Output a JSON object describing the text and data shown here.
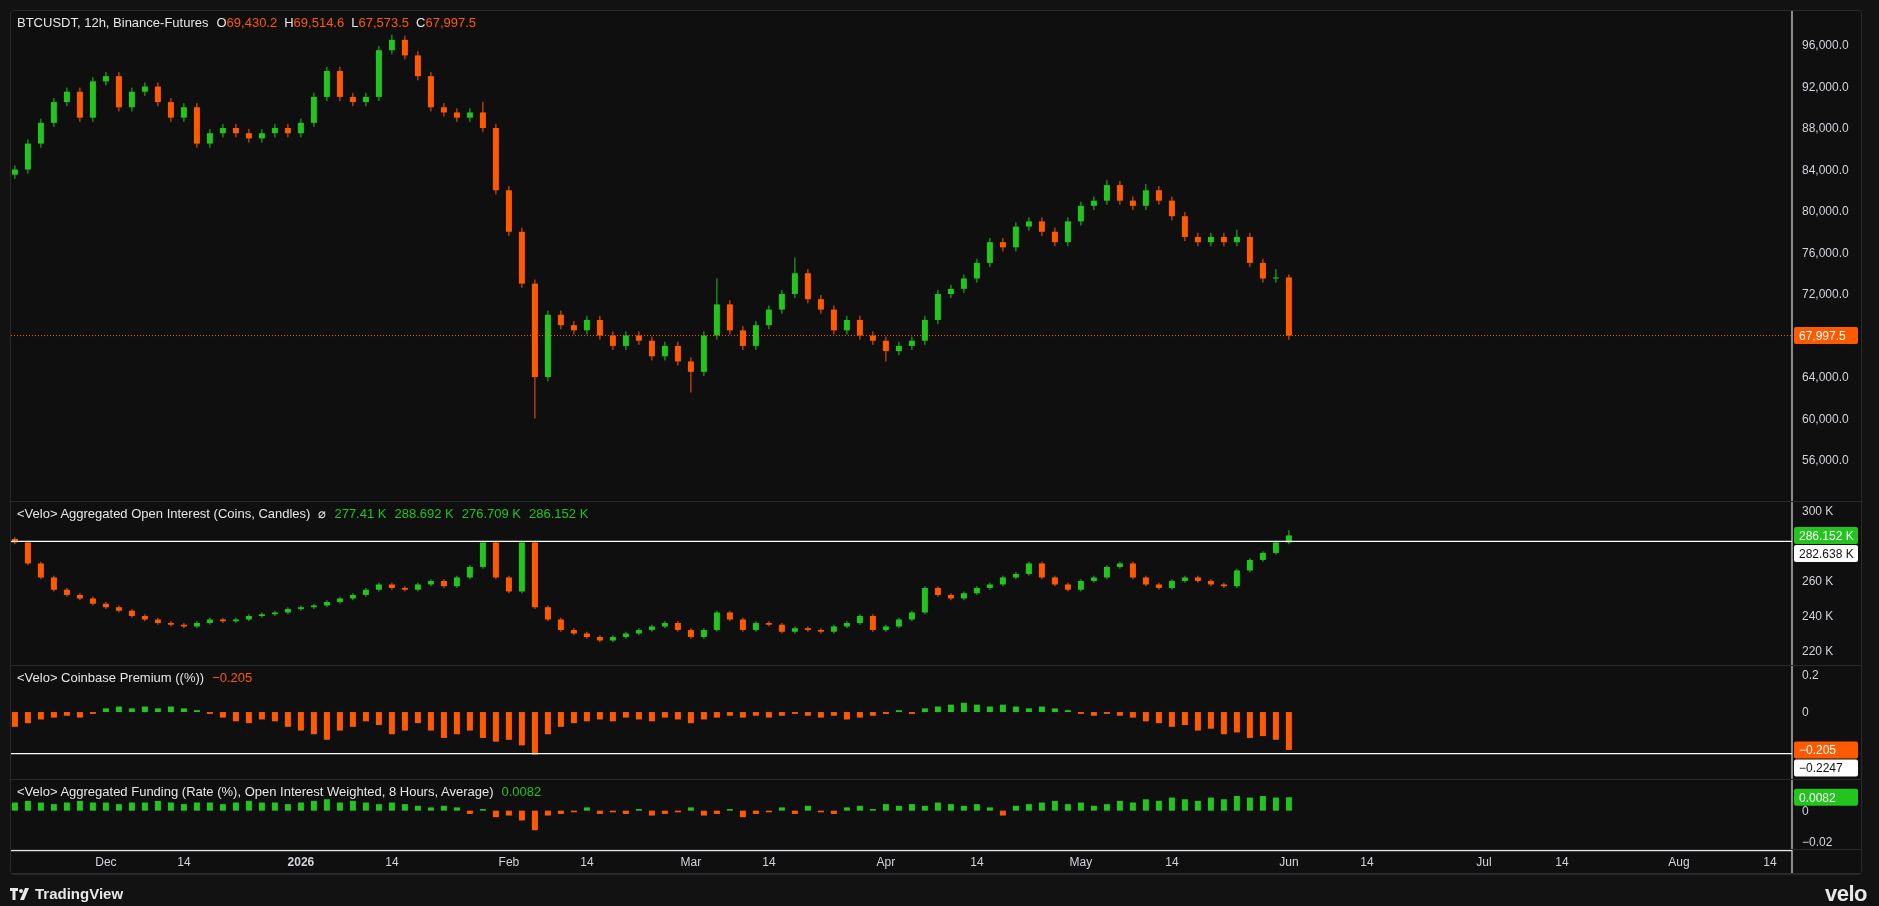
{
  "price_pane": {
    "legend": {
      "title": "BTCUSDT, 12h, Binance-Futures",
      "ohlc": [
        {
          "key": "O",
          "value": "69,430.2",
          "falling": true
        },
        {
          "key": "H",
          "value": "69,514.6",
          "falling": true
        },
        {
          "key": "L",
          "value": "67,573.5",
          "falling": true
        },
        {
          "key": "C",
          "value": "67,997.5",
          "falling": true
        }
      ]
    },
    "chart_data": {
      "type": "candlestick",
      "ylim": [
        52050,
        99280
      ],
      "categories": [
        null,
        null,
        null,
        null,
        null,
        null,
        null,
        null,
        null,
        null,
        null,
        null,
        null,
        null,
        null,
        null,
        null,
        null,
        null,
        null,
        null,
        null,
        null,
        null,
        null,
        null,
        null,
        null,
        null,
        null,
        null,
        null,
        null,
        null,
        null,
        null,
        null,
        null,
        null,
        null,
        null,
        null,
        null,
        null,
        null,
        null,
        null,
        null,
        null,
        null,
        null,
        null,
        null,
        null,
        null,
        null,
        null,
        null,
        null,
        null,
        null,
        null,
        null,
        null,
        null,
        null,
        null,
        null,
        null,
        null,
        null,
        null,
        null,
        null,
        null,
        null,
        null,
        null,
        null,
        null,
        null,
        null,
        null,
        null,
        null,
        null,
        null,
        null,
        null,
        null,
        null,
        null,
        null,
        null,
        null,
        null,
        null,
        null,
        null,
        null,
        null,
        null,
        null,
        null,
        null,
        null,
        null,
        null,
        null,
        null,
        null,
        null,
        null,
        null,
        null,
        null,
        null,
        null,
        null,
        null,
        null,
        null,
        null,
        null,
        null,
        null,
        null,
        null,
        null,
        null,
        null,
        null,
        null,
        null,
        null,
        null,
        null
      ],
      "ohlc": [
        [
          83500,
          84400,
          83100,
          84000
        ],
        [
          84000,
          86900,
          83600,
          86500
        ],
        [
          86500,
          88900,
          86100,
          88500
        ],
        [
          88500,
          90900,
          88100,
          90500
        ],
        [
          90500,
          91900,
          90100,
          91500
        ],
        [
          91500,
          91900,
          88600,
          89000
        ],
        [
          89000,
          92900,
          88600,
          92500
        ],
        [
          92500,
          93400,
          92100,
          93000
        ],
        [
          93000,
          93400,
          89600,
          90000
        ],
        [
          90000,
          91900,
          89600,
          91500
        ],
        [
          91500,
          92400,
          91100,
          92000
        ],
        [
          92000,
          92400,
          90100,
          90500
        ],
        [
          90500,
          90900,
          88600,
          89000
        ],
        [
          89000,
          90400,
          88600,
          90000
        ],
        [
          90000,
          90400,
          86100,
          86500
        ],
        [
          86500,
          87900,
          86100,
          87500
        ],
        [
          87500,
          88400,
          87100,
          88000
        ],
        [
          88000,
          88400,
          87100,
          87500
        ],
        [
          87500,
          87900,
          86600,
          87000
        ],
        [
          87000,
          87900,
          86600,
          87500
        ],
        [
          87500,
          88400,
          87100,
          88000
        ],
        [
          88000,
          88400,
          87100,
          87500
        ],
        [
          87500,
          88900,
          87100,
          88500
        ],
        [
          88500,
          91400,
          88100,
          91000
        ],
        [
          91000,
          93900,
          90600,
          93500
        ],
        [
          93500,
          93900,
          90600,
          91000
        ],
        [
          91000,
          91400,
          90100,
          90500
        ],
        [
          90500,
          91400,
          90100,
          91000
        ],
        [
          91000,
          95900,
          90600,
          95500
        ],
        [
          95500,
          97000,
          95100,
          96500
        ],
        [
          96500,
          96900,
          94600,
          95000
        ],
        [
          95000,
          95400,
          92600,
          93000
        ],
        [
          93000,
          93400,
          89600,
          90000
        ],
        [
          90000,
          90400,
          89100,
          89500
        ],
        [
          89500,
          89900,
          88600,
          89000
        ],
        [
          89000,
          89900,
          88600,
          89500
        ],
        [
          89500,
          90500,
          87600,
          88000
        ],
        [
          88000,
          88400,
          81600,
          82000
        ],
        [
          82000,
          82400,
          77600,
          78000
        ],
        [
          78000,
          78400,
          72600,
          73000
        ],
        [
          73000,
          73400,
          60000,
          64000
        ],
        [
          64000,
          70400,
          63600,
          70000
        ],
        [
          70000,
          70400,
          68600,
          69000
        ],
        [
          69000,
          69400,
          68100,
          68500
        ],
        [
          68500,
          69900,
          68100,
          69500
        ],
        [
          69500,
          69900,
          67600,
          68000
        ],
        [
          68000,
          68400,
          66600,
          67000
        ],
        [
          67000,
          68400,
          66600,
          68000
        ],
        [
          68000,
          68400,
          67100,
          67500
        ],
        [
          67500,
          67900,
          65600,
          66000
        ],
        [
          66000,
          67400,
          65600,
          67000
        ],
        [
          67000,
          67400,
          65100,
          65500
        ],
        [
          65500,
          65900,
          62500,
          64500
        ],
        [
          64500,
          68400,
          64100,
          68000
        ],
        [
          68000,
          73500,
          67600,
          71000
        ],
        [
          71000,
          71400,
          68100,
          68500
        ],
        [
          68500,
          68900,
          66600,
          67000
        ],
        [
          67000,
          69400,
          66600,
          69000
        ],
        [
          69000,
          70900,
          68600,
          70500
        ],
        [
          70500,
          72400,
          70100,
          72000
        ],
        [
          72000,
          75500,
          71600,
          74000
        ],
        [
          74000,
          74400,
          71100,
          71500
        ],
        [
          71500,
          71900,
          70100,
          70500
        ],
        [
          70500,
          70900,
          68100,
          68500
        ],
        [
          68500,
          69900,
          68100,
          69500
        ],
        [
          69500,
          69900,
          67600,
          68000
        ],
        [
          68000,
          68400,
          67100,
          67500
        ],
        [
          67500,
          67900,
          65500,
          66500
        ],
        [
          66500,
          67400,
          66100,
          67000
        ],
        [
          67000,
          67900,
          66600,
          67500
        ],
        [
          67500,
          69900,
          67100,
          69500
        ],
        [
          69500,
          72400,
          69100,
          72000
        ],
        [
          72000,
          72900,
          71600,
          72500
        ],
        [
          72500,
          73900,
          72100,
          73500
        ],
        [
          73500,
          75400,
          73100,
          75000
        ],
        [
          75000,
          77400,
          74600,
          77000
        ],
        [
          77000,
          77400,
          76100,
          76500
        ],
        [
          76500,
          78900,
          76100,
          78500
        ],
        [
          78500,
          79400,
          78100,
          79000
        ],
        [
          79000,
          79400,
          77600,
          78000
        ],
        [
          78000,
          78400,
          76600,
          77000
        ],
        [
          77000,
          79400,
          76600,
          79000
        ],
        [
          79000,
          80900,
          78600,
          80500
        ],
        [
          80500,
          81400,
          80100,
          81000
        ],
        [
          81000,
          83000,
          80600,
          82500
        ],
        [
          82500,
          82900,
          80600,
          81000
        ],
        [
          81000,
          81400,
          80100,
          80500
        ],
        [
          80500,
          82600,
          80100,
          82000
        ],
        [
          82000,
          82400,
          80600,
          81000
        ],
        [
          81000,
          81400,
          79100,
          79500
        ],
        [
          79500,
          79900,
          77100,
          77500
        ],
        [
          77500,
          77900,
          76600,
          77000
        ],
        [
          77000,
          77900,
          76600,
          77500
        ],
        [
          77500,
          77900,
          76600,
          77000
        ],
        [
          77000,
          78200,
          76600,
          77500
        ],
        [
          77500,
          77900,
          74600,
          75000
        ],
        [
          75000,
          75400,
          73100,
          73500
        ],
        [
          73500,
          74400,
          73100,
          73600
        ],
        [
          73600,
          73900,
          67573.5,
          67997.5
        ],
        null,
        null,
        null,
        null,
        null,
        null,
        null,
        null,
        null,
        null,
        null,
        null,
        null,
        null,
        null,
        null,
        null,
        null,
        null,
        null,
        null,
        null,
        null,
        null,
        null,
        null,
        null,
        null,
        null,
        null,
        null,
        null,
        null,
        null,
        null,
        null,
        null,
        null
      ],
      "yticks": [
        {
          "value": 96000,
          "label": "96,000.0"
        },
        {
          "value": 92000,
          "label": "92,000.0"
        },
        {
          "value": 88000,
          "label": "88,000.0"
        },
        {
          "value": 84000,
          "label": "84,000.0"
        },
        {
          "value": 80000,
          "label": "80,000.0"
        },
        {
          "value": 76000,
          "label": "76,000.0"
        },
        {
          "value": 72000,
          "label": "72,000.0"
        },
        {
          "value": 64000,
          "label": "64,000.0"
        },
        {
          "value": 60000,
          "label": "60,000.0"
        },
        {
          "value": 56000,
          "label": "56,000.0"
        }
      ],
      "ref_lines": [
        {
          "axis": "y",
          "value": 67997.5,
          "label": "67,997.5",
          "color": "#ff5a00"
        }
      ]
    }
  },
  "open_interest_pane": {
    "legend": {
      "title": "<Velo> Aggregated Open Interest (Coins, Candles)",
      "symbol": "⌀",
      "values": [
        {
          "value": "277.41 K",
          "falling": false
        },
        {
          "value": "288.692 K",
          "falling": false
        },
        {
          "value": "276.709 K",
          "falling": false
        },
        {
          "value": "286.152 K",
          "falling": false
        }
      ]
    },
    "last_value_badge": {
      "label": "286.152 K",
      "falling": false
    },
    "chart_data": {
      "type": "candlestick",
      "ylim": [
        212,
        305.1
      ],
      "categories": [
        null,
        null,
        null,
        null,
        null,
        null,
        null,
        null,
        null,
        null,
        null,
        null,
        null,
        null,
        null,
        null,
        null,
        null,
        null,
        null,
        null,
        null,
        null,
        null,
        null,
        null,
        null,
        null,
        null,
        null,
        null,
        null,
        null,
        null,
        null,
        null,
        null,
        null,
        null,
        null,
        null,
        null,
        null,
        null,
        null,
        null,
        null,
        null,
        null,
        null,
        null,
        null,
        null,
        null,
        null,
        null,
        null,
        null,
        null,
        null,
        null,
        null,
        null,
        null,
        null,
        null,
        null,
        null,
        null,
        null,
        null,
        null,
        null,
        null,
        null,
        null,
        null,
        null,
        null,
        null,
        null,
        null,
        null,
        null,
        null,
        null,
        null,
        null,
        null,
        null,
        null,
        null,
        null,
        null,
        null,
        null,
        null,
        null,
        null,
        null,
        null,
        null,
        null,
        null,
        null,
        null,
        null,
        null,
        null,
        null,
        null,
        null,
        null,
        null,
        null,
        null,
        null,
        null,
        null,
        null,
        null,
        null,
        null,
        null,
        null,
        null,
        null,
        null,
        null,
        null,
        null,
        null,
        null,
        null,
        null,
        null,
        null
      ],
      "ohlc": [
        [
          284,
          285,
          281,
          282
        ],
        [
          282,
          283,
          269,
          270
        ],
        [
          270,
          271,
          261,
          262
        ],
        [
          262,
          263,
          254,
          255
        ],
        [
          255,
          256,
          251,
          252
        ],
        [
          252,
          253,
          249,
          250
        ],
        [
          250,
          251,
          246,
          247
        ],
        [
          247,
          248,
          244,
          245
        ],
        [
          245,
          246,
          242,
          243
        ],
        [
          243,
          244,
          239,
          240
        ],
        [
          240,
          241,
          237,
          238
        ],
        [
          238,
          239,
          235,
          236
        ],
        [
          236,
          237,
          234,
          235
        ],
        [
          235,
          236,
          233,
          234
        ],
        [
          234,
          237,
          233,
          236
        ],
        [
          236,
          239,
          235,
          238
        ],
        [
          238,
          239,
          236,
          237
        ],
        [
          237,
          239,
          236,
          238
        ],
        [
          238,
          241,
          237,
          240
        ],
        [
          240,
          242,
          239,
          241
        ],
        [
          241,
          243,
          240,
          242
        ],
        [
          242,
          245,
          241,
          244
        ],
        [
          244,
          246,
          243,
          245
        ],
        [
          245,
          247,
          244,
          246
        ],
        [
          246,
          249,
          245,
          248
        ],
        [
          248,
          251,
          247,
          250
        ],
        [
          250,
          253,
          249,
          252
        ],
        [
          252,
          256,
          251,
          255
        ],
        [
          255,
          259,
          254,
          258
        ],
        [
          258,
          259,
          255,
          256
        ],
        [
          256,
          257,
          254,
          255
        ],
        [
          255,
          259,
          254,
          258
        ],
        [
          258,
          261,
          257,
          260
        ],
        [
          260,
          261,
          256,
          257
        ],
        [
          257,
          263,
          256,
          262
        ],
        [
          262,
          269,
          261,
          268
        ],
        [
          268,
          283,
          267,
          282
        ],
        [
          282,
          283,
          261,
          262
        ],
        [
          262,
          263,
          253,
          254
        ],
        [
          254,
          283,
          253,
          282
        ],
        [
          282,
          283,
          244,
          245
        ],
        [
          245,
          246,
          237,
          238
        ],
        [
          238,
          239,
          231,
          232
        ],
        [
          232,
          233,
          229,
          230
        ],
        [
          230,
          231,
          227,
          228
        ],
        [
          228,
          229,
          225,
          226
        ],
        [
          226,
          229,
          225,
          228
        ],
        [
          228,
          231,
          227,
          230
        ],
        [
          230,
          233,
          229,
          232
        ],
        [
          232,
          235,
          231,
          234
        ],
        [
          234,
          237,
          233,
          236
        ],
        [
          236,
          237,
          231,
          232
        ],
        [
          232,
          233,
          227,
          228
        ],
        [
          228,
          233,
          227,
          232
        ],
        [
          232,
          243,
          231,
          242
        ],
        [
          242,
          243,
          237,
          238
        ],
        [
          238,
          239,
          231,
          232
        ],
        [
          232,
          237,
          231,
          236
        ],
        [
          236,
          237,
          234,
          235
        ],
        [
          235,
          236,
          230,
          231
        ],
        [
          231,
          234,
          230,
          233
        ],
        [
          233,
          234,
          231,
          232
        ],
        [
          232,
          233,
          230,
          231
        ],
        [
          231,
          235,
          230,
          234
        ],
        [
          234,
          237,
          233,
          236
        ],
        [
          236,
          241,
          235,
          240
        ],
        [
          240,
          241,
          231,
          232
        ],
        [
          232,
          235,
          231,
          234
        ],
        [
          234,
          239,
          233,
          238
        ],
        [
          238,
          243,
          237,
          242
        ],
        [
          242,
          257,
          241,
          256
        ],
        [
          256,
          257,
          251,
          252
        ],
        [
          252,
          253,
          249,
          250
        ],
        [
          250,
          254,
          249,
          253
        ],
        [
          253,
          257,
          252,
          256
        ],
        [
          256,
          259,
          255,
          258
        ],
        [
          258,
          263,
          257,
          262
        ],
        [
          262,
          265,
          261,
          264
        ],
        [
          264,
          271,
          263,
          270
        ],
        [
          270,
          271,
          261,
          262
        ],
        [
          262,
          263,
          257,
          258
        ],
        [
          258,
          259,
          254,
          255
        ],
        [
          255,
          261,
          254,
          260
        ],
        [
          260,
          263,
          259,
          262
        ],
        [
          262,
          269,
          261,
          268
        ],
        [
          268,
          271,
          267,
          270
        ],
        [
          270,
          271,
          261,
          262
        ],
        [
          262,
          263,
          257,
          258
        ],
        [
          258,
          259,
          255,
          256
        ],
        [
          256,
          261,
          255,
          260
        ],
        [
          260,
          263,
          259,
          262
        ],
        [
          262,
          263,
          259,
          260
        ],
        [
          260,
          261,
          257,
          258
        ],
        [
          258,
          259,
          256,
          257
        ],
        [
          257,
          267,
          256,
          266
        ],
        [
          266,
          273,
          265,
          272
        ],
        [
          272,
          277,
          271,
          276
        ],
        [
          276,
          283,
          275,
          282
        ],
        [
          282,
          289,
          281,
          286
        ],
        null,
        null,
        null,
        null,
        null,
        null,
        null,
        null,
        null,
        null,
        null,
        null,
        null,
        null,
        null,
        null,
        null,
        null,
        null,
        null,
        null,
        null,
        null,
        null,
        null,
        null,
        null,
        null,
        null,
        null,
        null,
        null,
        null,
        null,
        null,
        null,
        null,
        null
      ],
      "yticks": [
        {
          "value": 300,
          "label": "300 K"
        },
        {
          "value": 260,
          "label": "260 K"
        },
        {
          "value": 240,
          "label": "240 K"
        },
        {
          "value": 220,
          "label": "220 K"
        }
      ],
      "ref_lines": [
        {
          "axis": "y",
          "value": 282.6,
          "label": "282.638 K",
          "color": "#ffffff"
        }
      ]
    }
  },
  "premium_pane": {
    "legend": {
      "title": "<Velo> Coinbase Premium ((%))",
      "values": [
        {
          "value": "−0.205",
          "falling": true
        }
      ]
    },
    "last_value_badge": {
      "label": "−0.205",
      "falling": true
    },
    "chart_data": {
      "type": "bar",
      "ylim": [
        -0.362,
        0.249
      ],
      "categories": [
        null,
        null,
        null,
        null,
        null,
        null,
        null,
        null,
        null,
        null,
        null,
        null,
        null,
        null,
        null,
        null,
        null,
        null,
        null,
        null,
        null,
        null,
        null,
        null,
        null,
        null,
        null,
        null,
        null,
        null,
        null,
        null,
        null,
        null,
        null,
        null,
        null,
        null,
        null,
        null,
        null,
        null,
        null,
        null,
        null,
        null,
        null,
        null,
        null,
        null,
        null,
        null,
        null,
        null,
        null,
        null,
        null,
        null,
        null,
        null,
        null,
        null,
        null,
        null,
        null,
        null,
        null,
        null,
        null,
        null,
        null,
        null,
        null,
        null,
        null,
        null,
        null,
        null,
        null,
        null,
        null,
        null,
        null,
        null,
        null,
        null,
        null,
        null,
        null,
        null,
        null,
        null,
        null,
        null,
        null,
        null,
        null,
        null,
        null,
        null,
        null,
        null,
        null,
        null,
        null,
        null,
        null,
        null,
        null,
        null,
        null,
        null,
        null,
        null,
        null,
        null,
        null,
        null,
        null,
        null,
        null,
        null,
        null,
        null,
        null,
        null,
        null,
        null,
        null,
        null,
        null,
        null,
        null,
        null,
        null,
        null,
        null
      ],
      "series": [
        {
          "values": [
            -0.08,
            -0.06,
            -0.04,
            -0.03,
            -0.02,
            -0.03,
            -0.01,
            0.02,
            0.03,
            0.02,
            0.03,
            0.02,
            0.03,
            0.02,
            0.01,
            -0.01,
            -0.03,
            -0.05,
            -0.06,
            -0.04,
            -0.05,
            -0.08,
            -0.1,
            -0.12,
            -0.15,
            -0.1,
            -0.08,
            -0.05,
            -0.07,
            -0.12,
            -0.1,
            -0.06,
            -0.1,
            -0.14,
            -0.12,
            -0.1,
            -0.14,
            -0.16,
            -0.15,
            -0.18,
            -0.23,
            -0.12,
            -0.08,
            -0.06,
            -0.05,
            -0.04,
            -0.05,
            -0.03,
            -0.04,
            -0.05,
            -0.03,
            -0.04,
            -0.06,
            -0.04,
            -0.03,
            -0.02,
            -0.03,
            -0.02,
            -0.03,
            -0.02,
            -0.01,
            -0.02,
            -0.03,
            -0.02,
            -0.04,
            -0.03,
            -0.02,
            -0.01,
            0.01,
            -0.01,
            0.02,
            0.03,
            0.04,
            0.05,
            0.04,
            0.03,
            0.04,
            0.03,
            0.02,
            0.03,
            0.02,
            0.01,
            -0.01,
            -0.02,
            -0.01,
            -0.02,
            -0.03,
            -0.05,
            -0.06,
            -0.08,
            -0.07,
            -0.1,
            -0.09,
            -0.12,
            -0.11,
            -0.14,
            -0.13,
            -0.15,
            -0.205,
            null,
            null,
            null,
            null,
            null,
            null,
            null,
            null,
            null,
            null,
            null,
            null,
            null,
            null,
            null,
            null,
            null,
            null,
            null,
            null,
            null,
            null,
            null,
            null,
            null,
            null,
            null,
            null,
            null,
            null,
            null,
            null,
            null,
            null,
            null,
            null,
            null,
            null
          ]
        }
      ],
      "yticks": [
        {
          "value": 0.2,
          "label": "0.2"
        },
        {
          "value": 0,
          "label": "0"
        }
      ],
      "ref_lines": [
        {
          "axis": "y",
          "value": -0.2247,
          "label": "−0.2247",
          "color": "#ffffff"
        }
      ]
    }
  },
  "funding_pane": {
    "legend": {
      "title": "<Velo> Aggregated Funding (Rate (%), Open Interest Weighted, 8 Hours, Average)",
      "values": [
        {
          "value": "0.0082",
          "falling": false
        }
      ]
    },
    "last_value_badge": {
      "label": "0.0082",
      "falling": false
    },
    "time_axis": [
      {
        "bold": false
      },
      {
        "bold": false
      },
      {
        "bold": true
      },
      {
        "bold": false
      },
      {
        "bold": false
      },
      {
        "bold": false
      },
      {
        "bold": false
      },
      {
        "bold": false
      },
      {
        "bold": false
      },
      {
        "bold": false
      },
      {
        "bold": false
      },
      {
        "bold": false
      },
      {
        "bold": false
      },
      {
        "bold": false
      },
      {
        "bold": false
      },
      {
        "bold": false
      },
      {
        "bold": false
      },
      {
        "bold": false
      }
    ],
    "chart_data": {
      "type": "bar",
      "ylim": [
        -0.0235,
        0.0188
      ],
      "categories": [
        null,
        null,
        null,
        null,
        null,
        null,
        null,
        "Dec",
        null,
        null,
        null,
        null,
        null,
        "14",
        null,
        null,
        null,
        null,
        null,
        null,
        null,
        null,
        "2026",
        null,
        null,
        null,
        null,
        null,
        null,
        "14",
        null,
        null,
        null,
        null,
        null,
        null,
        null,
        null,
        "Feb",
        null,
        null,
        null,
        null,
        null,
        "14",
        null,
        null,
        null,
        null,
        null,
        null,
        null,
        "Mar",
        null,
        null,
        null,
        null,
        null,
        "14",
        null,
        null,
        null,
        null,
        null,
        null,
        null,
        null,
        "Apr",
        null,
        null,
        null,
        null,
        null,
        null,
        "14",
        null,
        null,
        null,
        null,
        null,
        null,
        null,
        "May",
        null,
        null,
        null,
        null,
        null,
        null,
        "14",
        null,
        null,
        null,
        null,
        null,
        null,
        null,
        null,
        "Jun",
        null,
        null,
        null,
        null,
        null,
        "14",
        null,
        null,
        null,
        null,
        null,
        null,
        null,
        null,
        "Jul",
        null,
        null,
        null,
        null,
        null,
        "14",
        null,
        null,
        null,
        null,
        null,
        null,
        null,
        null,
        "Aug",
        null,
        null,
        null,
        null,
        null,
        null,
        "14",
        null
      ],
      "series": [
        {
          "values": [
            0.005,
            0.006,
            0.005,
            0.004,
            0.005,
            0.006,
            0.005,
            0.005,
            0.004,
            0.005,
            0.005,
            0.006,
            0.005,
            0.004,
            0.005,
            0.005,
            0.004,
            0.005,
            0.006,
            0.005,
            0.005,
            0.004,
            0.005,
            0.006,
            0.007,
            0.005,
            0.006,
            0.005,
            0.004,
            0.005,
            0.004,
            0.003,
            0.002,
            0.003,
            0.002,
            -0.002,
            0.001,
            -0.004,
            -0.003,
            -0.006,
            -0.012,
            -0.003,
            -0.002,
            -0.001,
            0.002,
            -0.002,
            -0.001,
            -0.002,
            0.001,
            -0.003,
            -0.002,
            -0.001,
            0.002,
            -0.003,
            -0.002,
            0.001,
            -0.004,
            -0.002,
            -0.001,
            0.002,
            -0.002,
            0.003,
            -0.001,
            -0.002,
            0.002,
            0.003,
            0.001,
            0.004,
            0.003,
            0.004,
            0.003,
            0.005,
            0.004,
            0.003,
            0.004,
            0.002,
            -0.003,
            0.003,
            0.004,
            0.005,
            0.006,
            0.004,
            0.005,
            0.003,
            0.004,
            0.006,
            0.005,
            0.007,
            0.006,
            0.008,
            0.007,
            0.006,
            0.008,
            0.007,
            0.009,
            0.008,
            0.009,
            0.008,
            0.0082,
            null,
            null,
            null,
            null,
            null,
            null,
            null,
            null,
            null,
            null,
            null,
            null,
            null,
            null,
            null,
            null,
            null,
            null,
            null,
            null,
            null,
            null,
            null,
            null,
            null,
            null,
            null,
            null,
            null,
            null,
            null,
            null,
            null,
            null,
            null,
            null,
            null,
            null
          ]
        }
      ],
      "yticks": [
        {
          "value": 0,
          "label": "0"
        },
        {
          "value": -0.0195,
          "label": "−0.02"
        }
      ]
    }
  },
  "footer": {
    "left_brand": "TradingView",
    "right_brand": "velo"
  }
}
